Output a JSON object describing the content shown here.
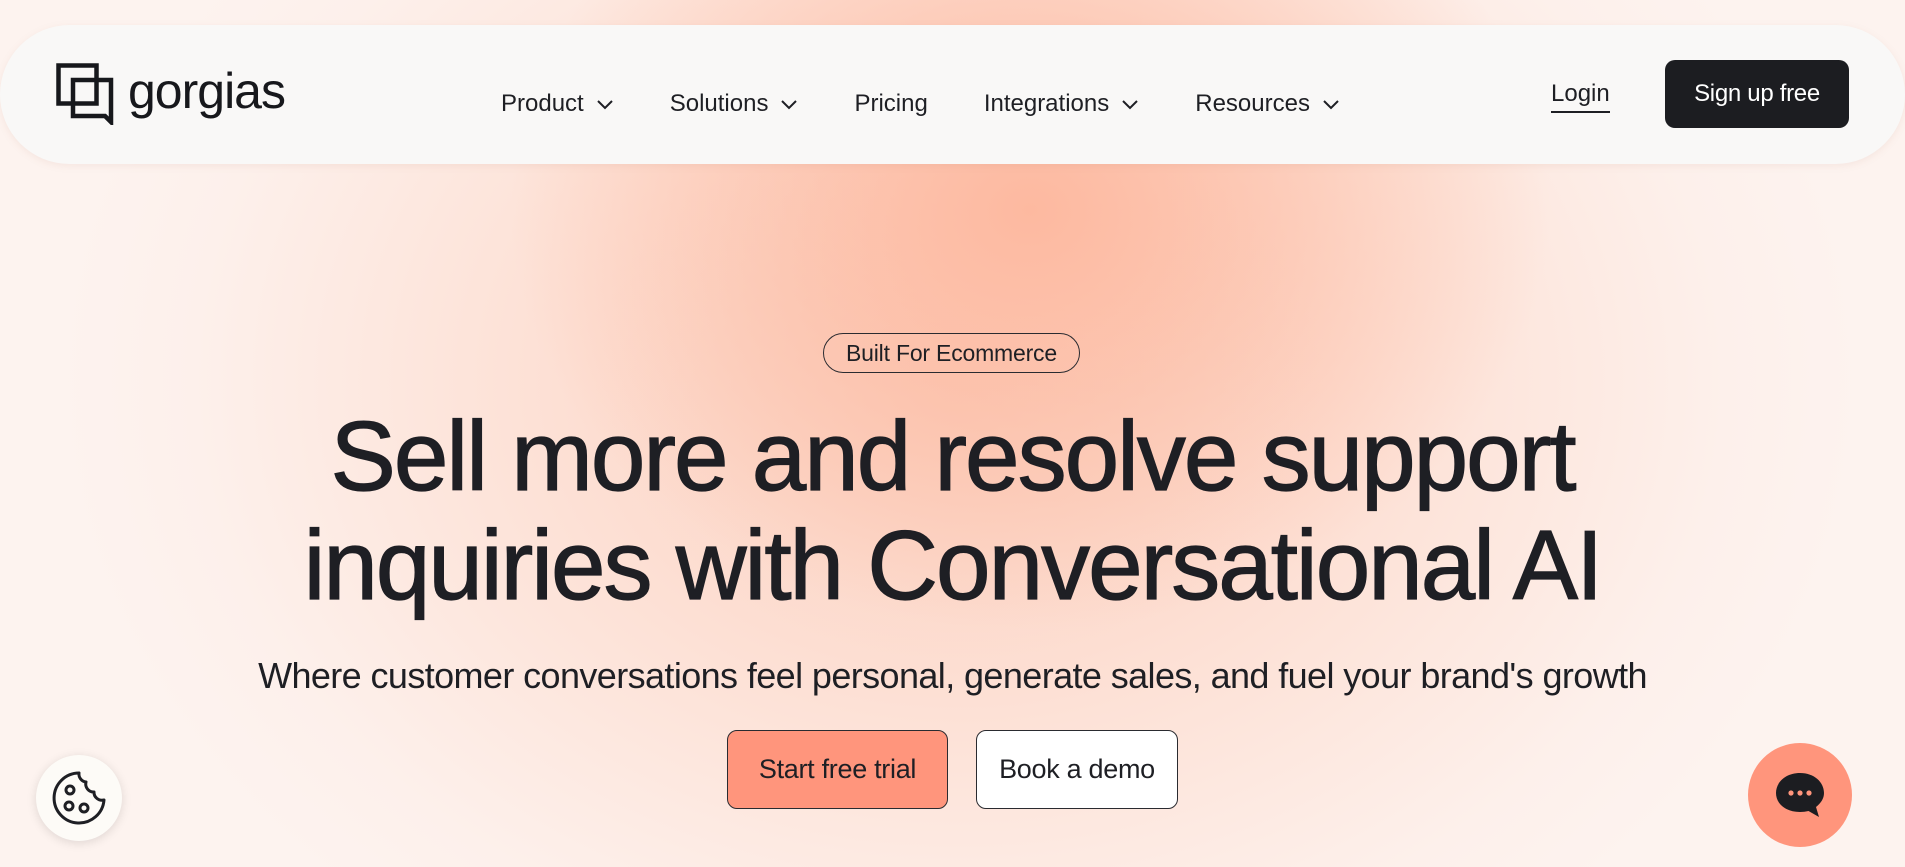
{
  "nav": {
    "logo_text": "gorgias",
    "logo_icon": "gorgias-logo-icon",
    "items": [
      {
        "label": "Product",
        "has_dropdown": true
      },
      {
        "label": "Solutions",
        "has_dropdown": true
      },
      {
        "label": "Pricing",
        "has_dropdown": false
      },
      {
        "label": "Integrations",
        "has_dropdown": true
      },
      {
        "label": "Resources",
        "has_dropdown": true
      }
    ],
    "login_label": "Login",
    "signup_label": "Sign up free"
  },
  "hero": {
    "badge": "Built For Ecommerce",
    "headline_line1": "Sell more and resolve support",
    "headline_line2": "inquiries with Conversational AI",
    "subheadline": "Where customer conversations feel personal, generate sales, and fuel your brand's growth",
    "primary_cta": "Start free trial",
    "secondary_cta": "Book a demo"
  },
  "widgets": {
    "cookie_icon": "cookie-icon",
    "chat_icon": "chat-bubble-icon"
  },
  "colors": {
    "accent": "#ff957c",
    "dark": "#1c1d21",
    "background_peach": "#fccdbb"
  }
}
